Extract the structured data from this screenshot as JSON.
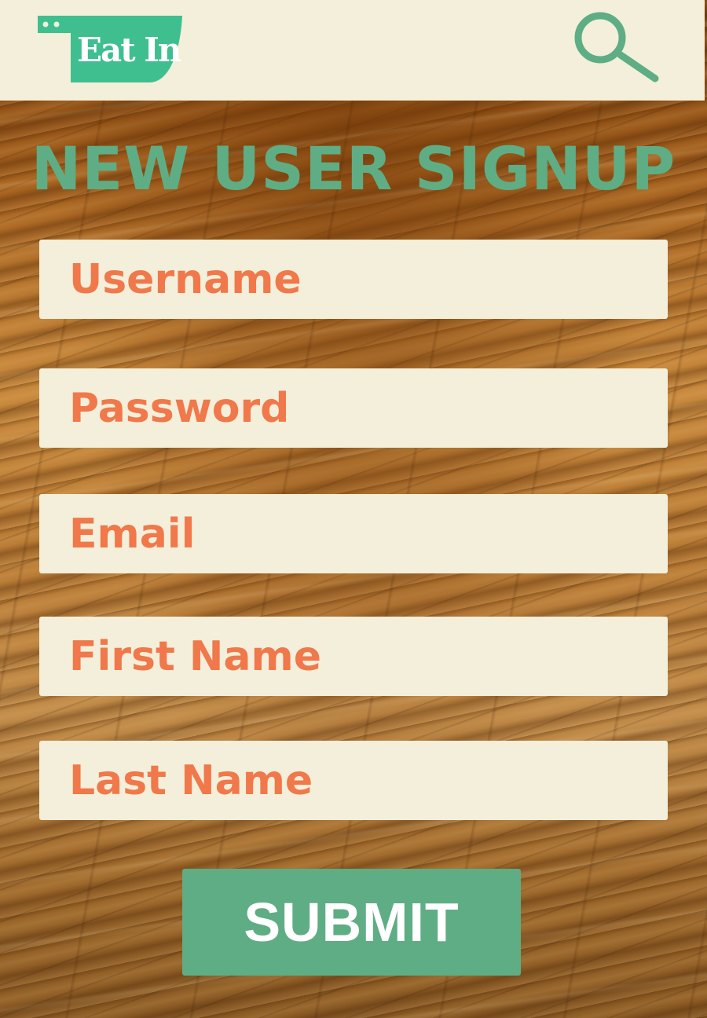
{
  "header": {
    "logo_text": "Eat In",
    "search_icon": "search-icon"
  },
  "page": {
    "title": "NEW USER SIGNUP"
  },
  "form": {
    "fields": [
      {
        "name": "username",
        "placeholder": "Username",
        "value": ""
      },
      {
        "name": "password",
        "placeholder": "Password",
        "value": ""
      },
      {
        "name": "email",
        "placeholder": "Email",
        "value": ""
      },
      {
        "name": "first_name",
        "placeholder": "First Name",
        "value": ""
      },
      {
        "name": "last_name",
        "placeholder": "Last Name",
        "value": ""
      }
    ],
    "submit_label": "SUBMIT"
  },
  "colors": {
    "accent_green": "#5fad84",
    "logo_green": "#3fbf8f",
    "field_bg": "#f3efda",
    "placeholder_orange": "#f0784a",
    "header_bg": "#f3efda"
  }
}
